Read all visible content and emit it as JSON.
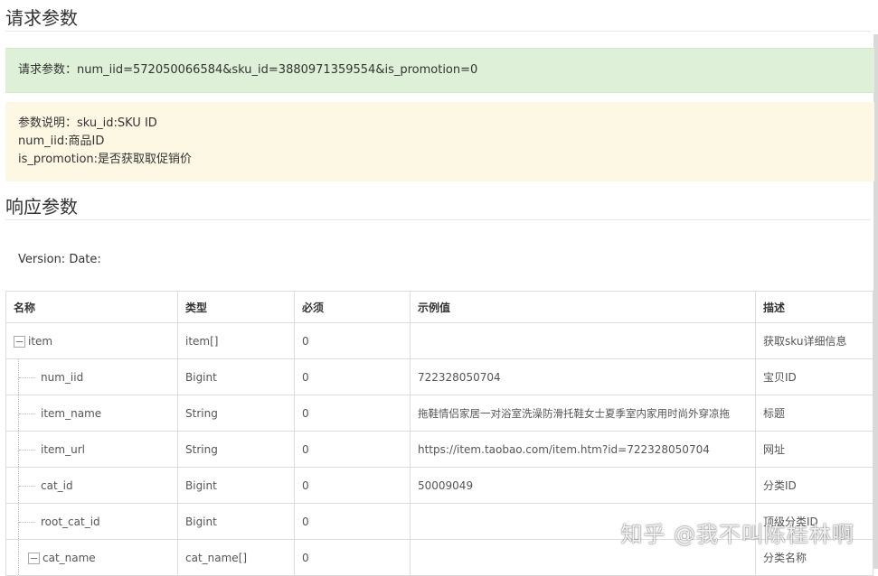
{
  "request": {
    "heading": "请求参数",
    "example_line": "请求参数：num_iid=572050066584&sku_id=3880971359554&is_promotion=0",
    "notes": [
      "参数说明：sku_id:SKU ID",
      "num_iid:商品ID",
      "is_promotion:是否获取取促销价"
    ]
  },
  "response": {
    "heading": "响应参数",
    "version_line": "Version: Date:"
  },
  "table": {
    "headers": [
      "名称",
      "类型",
      "必须",
      "示例值",
      "描述"
    ],
    "rows": [
      {
        "name": "item",
        "type": "item[]",
        "required": "0",
        "example": "",
        "desc": "获取sku详细信息",
        "level": 0,
        "collapsible": true
      },
      {
        "name": "num_iid",
        "type": "Bigint",
        "required": "0",
        "example": "722328050704",
        "desc": "宝贝ID",
        "level": 1
      },
      {
        "name": "item_name",
        "type": "String",
        "required": "0",
        "example": "拖鞋情侣家居一对浴室洗澡防滑托鞋女士夏季室内家用时尚外穿凉拖",
        "desc": "标题",
        "level": 1
      },
      {
        "name": "item_url",
        "type": "String",
        "required": "0",
        "example": "https://item.taobao.com/item.htm?id=722328050704",
        "desc": "网址",
        "level": 1
      },
      {
        "name": "cat_id",
        "type": "Bigint",
        "required": "0",
        "example": "50009049",
        "desc": "分类ID",
        "level": 1
      },
      {
        "name": "root_cat_id",
        "type": "Bigint",
        "required": "0",
        "example": "",
        "desc": "顶级分类ID",
        "level": 1
      },
      {
        "name": "cat_name",
        "type": "cat_name[]",
        "required": "0",
        "example": "",
        "desc": "分类名称",
        "level": 1,
        "collapsible": true
      }
    ]
  },
  "watermark": "知乎 @我不叫陈桂林啊",
  "colors": {
    "success_bg": "#dff0d8",
    "warning_bg": "#fcf8e3",
    "border": "#dddddd"
  }
}
